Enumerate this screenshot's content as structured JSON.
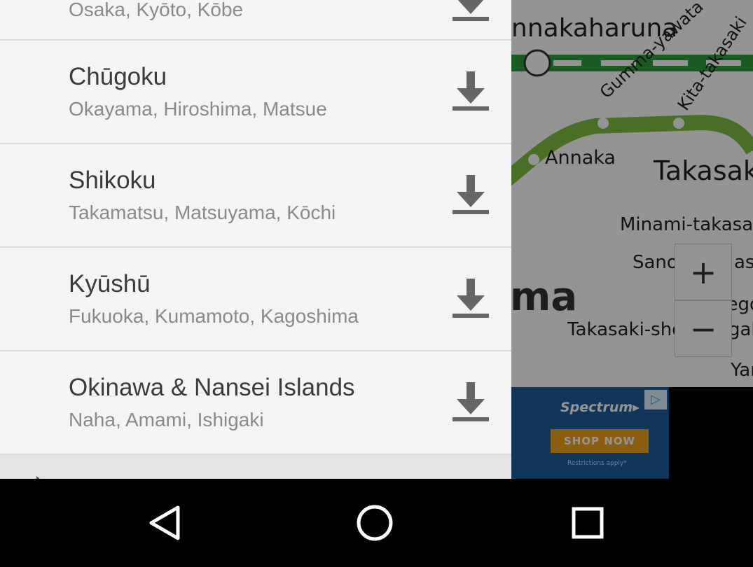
{
  "map": {
    "labels": {
      "haruna": "nnakaharuna",
      "gumma_yawata": "Gumma-yawata",
      "kita_takasaki": "Kita-takasaki",
      "annaka": "Annaka",
      "takasaki": "Takasaki",
      "minami_takasaki": "Minami-takasaki",
      "sano": "Sano",
      "sano_rest": "ash",
      "region_fragment": "ma",
      "nego": "Nego",
      "takasaki_sho": "Takasaki-shō",
      "sho_rest": "gak",
      "yan": "Yan"
    },
    "zoom_in_label": "+",
    "zoom_out_label": "−"
  },
  "ad": {
    "brand": "Spectrum▸",
    "cta": "SHOP NOW",
    "fine_print": "Restrictions apply*",
    "adchoices": "▷"
  },
  "regions": [
    {
      "title": "",
      "subtitle": "Osaka, Kyōto, Kōbe"
    },
    {
      "title": "Chūgoku",
      "subtitle": "Okayama, Hiroshima, Matsue"
    },
    {
      "title": "Shikoku",
      "subtitle": "Takamatsu, Matsuyama, Kōchi"
    },
    {
      "title": "Kyūshū",
      "subtitle": "Fukuoka, Kumamoto, Kagoshima"
    },
    {
      "title": "Okinawa & Nansei Islands",
      "subtitle": "Naha, Amami, Ishigaki"
    }
  ],
  "icons": {
    "download": "download-icon",
    "back": "back-triangle-icon",
    "home": "home-circle-icon",
    "recents": "recents-square-icon"
  },
  "colors": {
    "drawer_bg": "#f4f4f4",
    "title": "#3b3b3b",
    "subtitle": "#8a8a8a",
    "divider": "#d9d9d9",
    "green_line": "#2e9e3f",
    "green_line2": "#7cc040",
    "ad_bg": "#1d5e9c",
    "ad_cta": "#f2a21c"
  }
}
